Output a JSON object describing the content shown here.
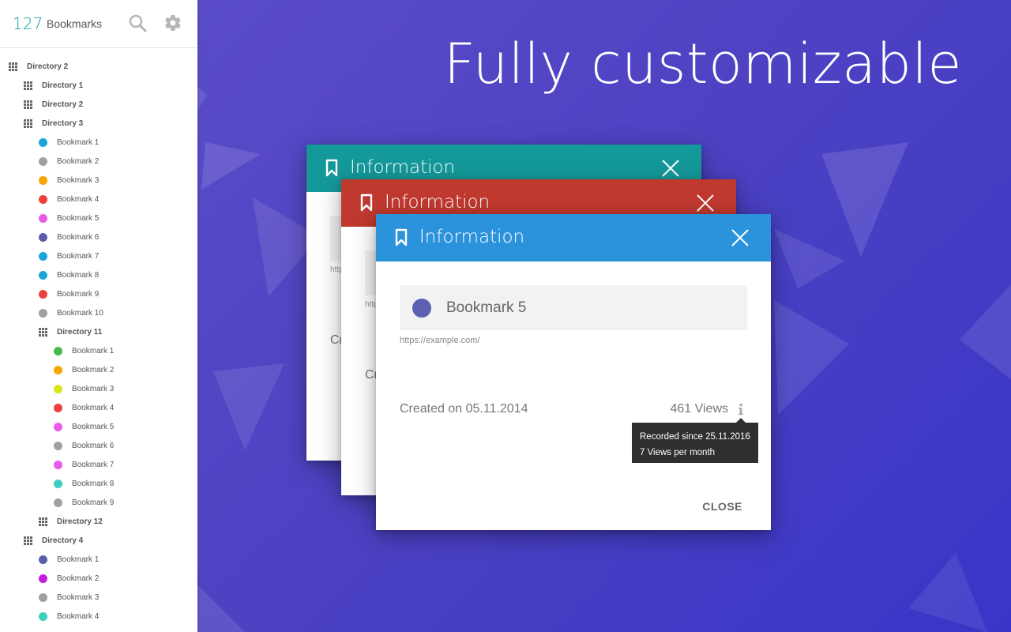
{
  "sidebar": {
    "count": "127",
    "title": "Bookmarks",
    "tree": [
      {
        "type": "dir",
        "label": "Directory 2",
        "depth": 0
      },
      {
        "type": "dir",
        "label": "Directory 1",
        "depth": 1
      },
      {
        "type": "dir",
        "label": "Directory 2",
        "depth": 1
      },
      {
        "type": "dir",
        "label": "Directory 3",
        "depth": 1
      },
      {
        "type": "bm",
        "label": "Bookmark 1",
        "depth": 2,
        "color": "#1aa6d8"
      },
      {
        "type": "bm",
        "label": "Bookmark 2",
        "depth": 2,
        "color": "#a0a0a0"
      },
      {
        "type": "bm",
        "label": "Bookmark 3",
        "depth": 2,
        "color": "#f7a600"
      },
      {
        "type": "bm",
        "label": "Bookmark 4",
        "depth": 2,
        "color": "#ef3f3f"
      },
      {
        "type": "bm",
        "label": "Bookmark 5",
        "depth": 2,
        "color": "#e85ce8"
      },
      {
        "type": "bm",
        "label": "Bookmark 6",
        "depth": 2,
        "color": "#5a5ea8"
      },
      {
        "type": "bm",
        "label": "Bookmark 7",
        "depth": 2,
        "color": "#1aa6d8"
      },
      {
        "type": "bm",
        "label": "Bookmark 8",
        "depth": 2,
        "color": "#1aa6d8"
      },
      {
        "type": "bm",
        "label": "Bookmark 9",
        "depth": 2,
        "color": "#ef3f3f"
      },
      {
        "type": "bm",
        "label": "Bookmark 10",
        "depth": 2,
        "color": "#a0a0a0"
      },
      {
        "type": "dir",
        "label": "Directory 11",
        "depth": 2
      },
      {
        "type": "bm",
        "label": "Bookmark 1",
        "depth": 3,
        "color": "#4cb84c"
      },
      {
        "type": "bm",
        "label": "Bookmark 2",
        "depth": 3,
        "color": "#f7a600"
      },
      {
        "type": "bm",
        "label": "Bookmark 3",
        "depth": 3,
        "color": "#d7e418"
      },
      {
        "type": "bm",
        "label": "Bookmark 4",
        "depth": 3,
        "color": "#ef3f3f"
      },
      {
        "type": "bm",
        "label": "Bookmark 5",
        "depth": 3,
        "color": "#e85ce8"
      },
      {
        "type": "bm",
        "label": "Bookmark 6",
        "depth": 3,
        "color": "#a0a0a0"
      },
      {
        "type": "bm",
        "label": "Bookmark 7",
        "depth": 3,
        "color": "#e85ce8"
      },
      {
        "type": "bm",
        "label": "Bookmark 8",
        "depth": 3,
        "color": "#3fcfc0"
      },
      {
        "type": "bm",
        "label": "Bookmark 9",
        "depth": 3,
        "color": "#a0a0a0"
      },
      {
        "type": "dir",
        "label": "Directory 12",
        "depth": 2
      },
      {
        "type": "dir",
        "label": "Directory 4",
        "depth": 1
      },
      {
        "type": "bm",
        "label": "Bookmark 1",
        "depth": 2,
        "color": "#5a5ea8"
      },
      {
        "type": "bm",
        "label": "Bookmark 2",
        "depth": 2,
        "color": "#c21ee0"
      },
      {
        "type": "bm",
        "label": "Bookmark 3",
        "depth": 2,
        "color": "#a0a0a0"
      },
      {
        "type": "bm",
        "label": "Bookmark 4",
        "depth": 2,
        "color": "#3fcfc0"
      }
    ]
  },
  "headline": "Fully customizable",
  "dialogs": {
    "teal": {
      "title": "Information",
      "ghost_url": "http",
      "ghost_created": "Cr"
    },
    "red": {
      "title": "Information",
      "ghost_url": "http",
      "ghost_created": "Cr"
    },
    "blue": {
      "title": "Information",
      "bookmark_name": "Bookmark 5",
      "bookmark_color": "#5d5fb0",
      "url": "https://example.com/",
      "created": "Created on 05.11.2014",
      "views": "461 Views",
      "tooltip_line1": "Recorded since 25.11.2016",
      "tooltip_line2": "7 Views per month",
      "close_label": "CLOSE"
    }
  },
  "colors": {
    "teal": "#14999a",
    "red": "#c0392f",
    "blue": "#2b93dc",
    "accent": "#1a9ea7"
  }
}
